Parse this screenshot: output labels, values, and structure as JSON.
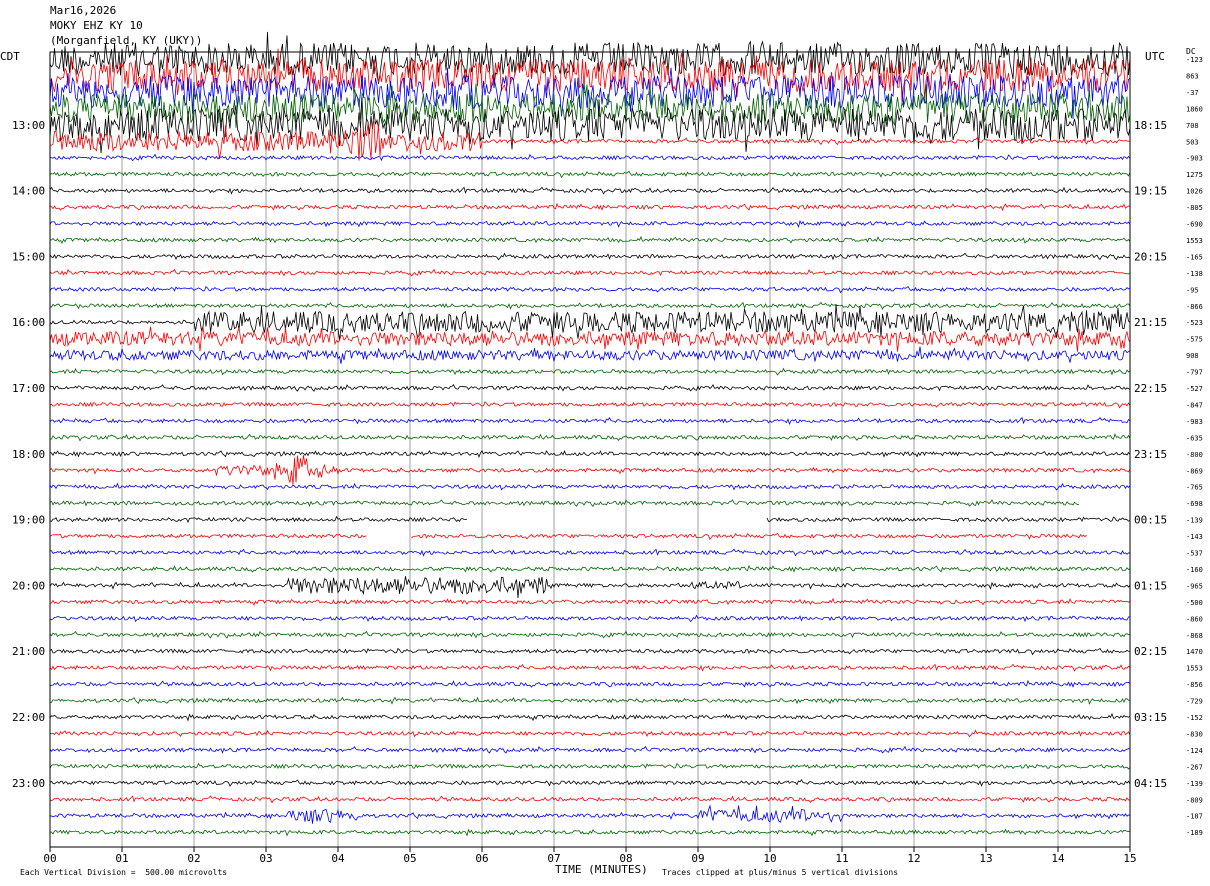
{
  "header": {
    "date": "Mar16,2026",
    "station": "MOKY EHZ KY 10",
    "location": "(Morganfield, KY (UKY))"
  },
  "labels": {
    "left_zone": "CDT",
    "right_zone": "UTC",
    "dc_label": "DC",
    "x_axis_title": "TIME (MINUTES)",
    "scale_note": "Each Vertical Division =  500.00 microvolts",
    "clip_note": "Traces clipped at plus/minus 5 vertical divisions"
  },
  "colors": {
    "trace_cycle": [
      "#000000",
      "#ff0000",
      "#0000ff",
      "#006400"
    ],
    "grid": "#a0a0a0",
    "background": "#ffffff"
  },
  "chart_data": {
    "type": "line",
    "title": "MOKY EHZ KY 10",
    "xlabel": "TIME (MINUTES)",
    "ylabel": "",
    "xlim": [
      0,
      15
    ],
    "x_ticks": [
      "00",
      "01",
      "02",
      "03",
      "04",
      "05",
      "06",
      "07",
      "08",
      "09",
      "10",
      "11",
      "12",
      "13",
      "14",
      "15"
    ],
    "traces_per_hour": 4,
    "trace_minutes": 15,
    "left_hour_labels": [
      "13:00",
      "14:00",
      "15:00",
      "16:00",
      "17:00",
      "18:00",
      "19:00",
      "20:00",
      "21:00",
      "22:00",
      "23:00"
    ],
    "right_hour_labels": [
      "18:15",
      "19:15",
      "20:15",
      "21:15",
      "22:15",
      "23:15",
      "00:15",
      "01:15",
      "02:15",
      "03:15",
      "04:15"
    ],
    "dc_offsets": [
      "-123",
      "863",
      "-37",
      "1860",
      "708",
      "503",
      "-903",
      "1275",
      "1026",
      "-805",
      "-690",
      "1553",
      "-165",
      "-138",
      "-95",
      "-866",
      "-523",
      "-575",
      "908",
      "-797",
      "-527",
      "-847",
      "-983",
      "-635",
      "-800",
      "-869",
      "-765",
      "-698",
      "-139",
      "-143",
      "-537",
      "-160",
      "-965",
      "-500",
      "-860",
      "-868",
      "1470",
      "1553",
      "-856",
      "-729",
      "-152",
      "-830",
      "-124",
      "-267",
      "-139",
      "-809",
      "-187",
      "-189"
    ],
    "events": [
      {
        "trace": 0,
        "from": 0,
        "to": 15,
        "amp": 5,
        "desc": "saturated"
      },
      {
        "trace": 1,
        "from": 0,
        "to": 15,
        "amp": 5
      },
      {
        "trace": 2,
        "from": 0,
        "to": 15,
        "amp": 5
      },
      {
        "trace": 3,
        "from": 0,
        "to": 15,
        "amp": 4.5
      },
      {
        "trace": 4,
        "from": 0,
        "to": 15,
        "amp": 5
      },
      {
        "trace": 5,
        "from": 0,
        "to": 6,
        "amp": 3
      },
      {
        "trace": 5,
        "from": 4.1,
        "to": 4.6,
        "amp": 6
      },
      {
        "trace": 16,
        "from": 2,
        "to": 15,
        "amp": 3.2
      },
      {
        "trace": 17,
        "from": 0,
        "to": 15,
        "amp": 2.2
      },
      {
        "trace": 18,
        "from": 0,
        "to": 15,
        "amp": 1.5
      },
      {
        "trace": 25,
        "from": 3.3,
        "to": 3.6,
        "amp": 5
      },
      {
        "trace": 25,
        "from": 2.3,
        "to": 4.0,
        "amp": 1.6
      },
      {
        "trace": 32,
        "from": 3.3,
        "to": 6.9,
        "amp": 2.6
      },
      {
        "trace": 32,
        "from": 8.9,
        "to": 9.6,
        "amp": 1.1
      },
      {
        "trace": 46,
        "from": 3.3,
        "to": 4.3,
        "amp": 2.0
      },
      {
        "trace": 46,
        "from": 9.0,
        "to": 11.0,
        "amp": 2.0
      }
    ],
    "gaps": [
      {
        "trace": 28,
        "from": 5.8,
        "to": 9.95
      },
      {
        "trace": 29,
        "from": 4.4,
        "to": 5.0
      },
      {
        "trace": 29,
        "from": 14.4,
        "to": 15
      },
      {
        "trace": 27,
        "from": 14.3,
        "to": 15
      }
    ]
  }
}
